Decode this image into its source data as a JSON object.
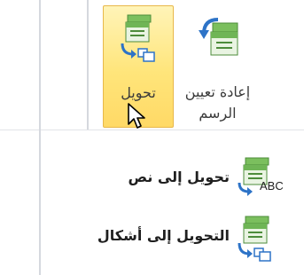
{
  "ribbon": {
    "convert_button": {
      "label": "تحويل"
    },
    "reset_button": {
      "label_line1": "إعادة تعيين",
      "label_line2": "الرسم"
    }
  },
  "menu": {
    "items": [
      {
        "label": "تحويل إلى نص",
        "icon_caption": "ABC"
      },
      {
        "label": "التحويل إلى أشكال"
      }
    ]
  },
  "colors": {
    "highlight_top": "#fff4b8",
    "highlight_bottom": "#ffd966",
    "highlight_border": "#e8b84a",
    "icon_green": "#5aa64a",
    "icon_blue": "#2d73c7"
  }
}
